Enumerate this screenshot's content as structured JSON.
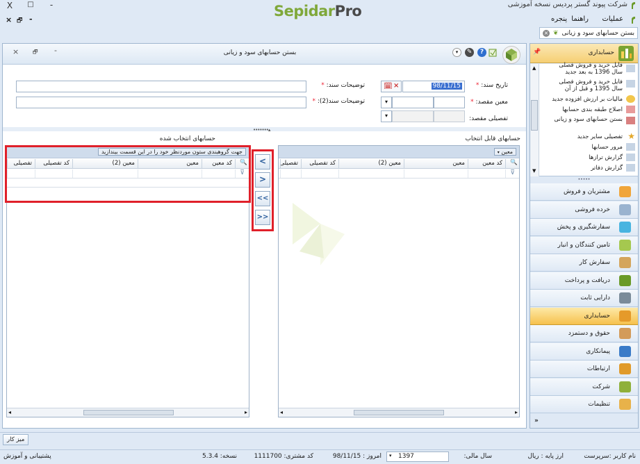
{
  "app": {
    "title": "شرکت پیوند گستر پردیس نسخه آموزشی",
    "brand_main": "Sepidar",
    "brand_suffix": "Pro",
    "window_buttons": [
      "-",
      "□",
      "X"
    ]
  },
  "menu": [
    "عملیات",
    "راهنما",
    "پنجره"
  ],
  "doc_tab": {
    "label": "بستن حسابهای سود و زیانی"
  },
  "form": {
    "title": "بستن حسابهای سود و زیانی",
    "fields": {
      "date_label": "تاریخ سند:",
      "date_value": "98/11/15",
      "desc_label": "توضیحات سند:",
      "moein_label": "معین مقصد:",
      "desc2_label": "توضیحات سند(2):",
      "tafsili_label": "تفصیلی مقصد:"
    }
  },
  "available": {
    "title": "حسابهای قابل انتخاب",
    "group_chip": "معین",
    "columns": [
      "کد معین",
      "معین",
      "معین (2)",
      "کد تفصیلی",
      "تفصیلی"
    ]
  },
  "selected": {
    "title": "حسابهای انتخاب شده",
    "group_hint": "جهت گروهبندی ستون موردنظر خود را در این قسمت بیندازید",
    "columns": [
      "کد معین",
      "معین",
      "معین (2)",
      "کد تفصیلی",
      "تفصیلی"
    ]
  },
  "transfer_buttons": [
    "<",
    ">",
    "<<",
    ">>"
  ],
  "nav": {
    "header": "حسابداری",
    "tree": [
      "فایل خرید و فروش فصلی سال 1396 به بعد جدید",
      "فایل خرید و فروش فصلی سال 1395 و قبل از آن",
      "مالیات بر ارزش افزوده جدید",
      "اصلاح طبقه بندی حسابها",
      "بستن حسابهای سود و زیانی",
      "تفصیلی سایر جدید",
      "مرور حسابها",
      "گزارش ترازها",
      "گزارش دفاتر"
    ],
    "modules": [
      "مشتریان و فروش",
      "خرده فروشی",
      "سفارشگیری و پخش",
      "تامین کنندگان و انبار",
      "سفارش کار",
      "دریافت و پرداخت",
      "دارایی ثابت",
      "حسابداری",
      "حقوق و دستمزد",
      "پیمانکاری",
      "ارتباطات",
      "شرکت",
      "تنظیمات"
    ],
    "active_module": "حسابداری"
  },
  "taskbar": {
    "desktop_button": "میز کار"
  },
  "status": {
    "user": "نام کاربر :سرپرست",
    "currency": "ارز پایه :  ریال",
    "fiscal_year_label": "سال مالی:",
    "fiscal_year": "1397",
    "today": "امروز :  98/11/15",
    "customer_code": "کد مشتری:  1111700",
    "version": "نسخه:  5.3.4",
    "support": "پشتیبانی و آموزش"
  },
  "colors": {
    "accent": "#7fa83a",
    "highlight": "#e0202a",
    "active_nav": "#f6c14d"
  }
}
